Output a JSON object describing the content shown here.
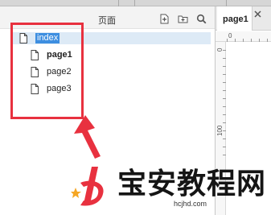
{
  "pages_panel": {
    "title": "页面",
    "tree": [
      {
        "label": "index",
        "selected": true,
        "bold": false
      },
      {
        "label": "page1",
        "selected": false,
        "bold": true
      },
      {
        "label": "page2",
        "selected": false,
        "bold": false
      },
      {
        "label": "page3",
        "selected": false,
        "bold": false
      }
    ],
    "icons": [
      "add-page-icon",
      "add-folder-icon",
      "search-icon"
    ]
  },
  "editor": {
    "tab_label": "page1",
    "ruler_top_numbers": [
      "0"
    ],
    "ruler_left_numbers": [
      "0",
      "100"
    ]
  },
  "watermark": {
    "brand": "宝安教程网",
    "url": "hcjhd.com"
  },
  "colors": {
    "highlight_red": "#e8313f",
    "selection_blue": "#3d8ee0",
    "selection_row": "#ddeaf6"
  }
}
